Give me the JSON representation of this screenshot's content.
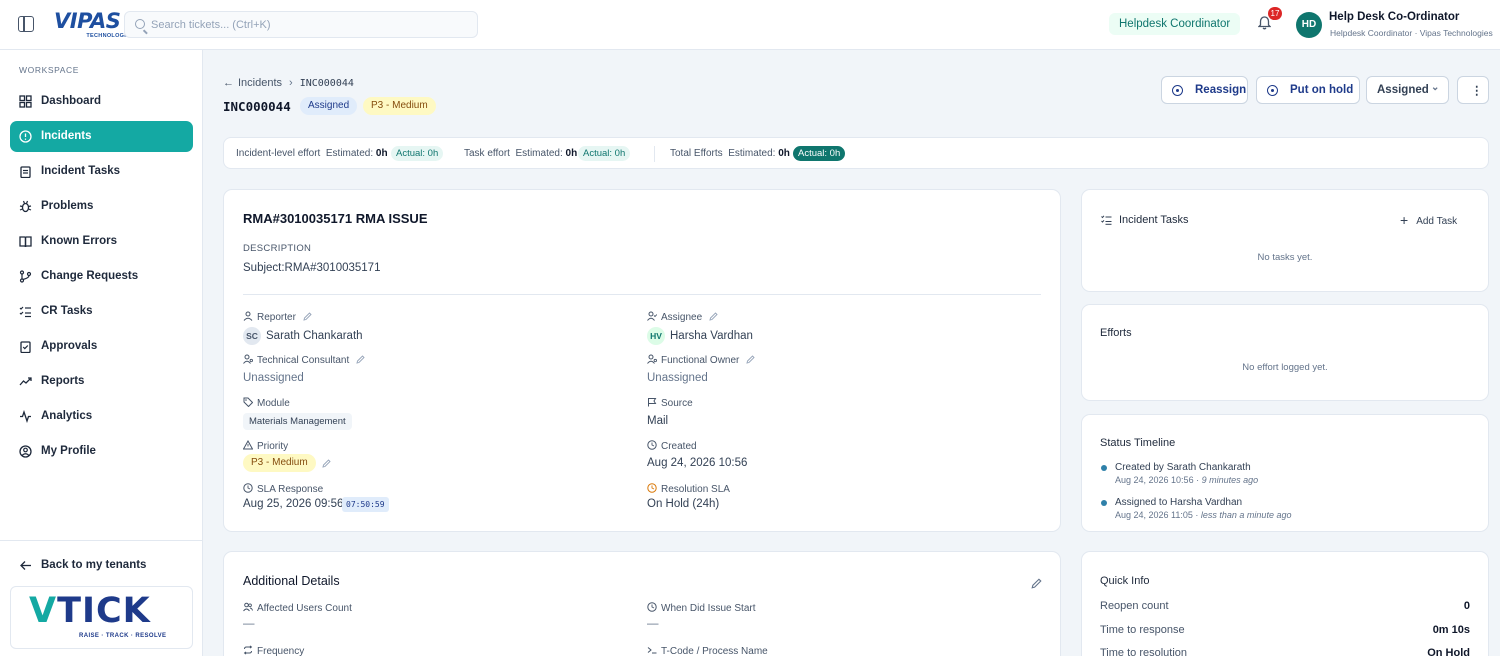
{
  "topbar": {
    "logo": "VIPAS",
    "logo_sub": "TECHNOLOGIES",
    "search_placeholder": "Search tickets... (Ctrl+K)",
    "role": "Helpdesk Coordinator",
    "notifications_count": "17",
    "avatar_initials": "HD",
    "user_name": "Help Desk Co-Ordinator",
    "user_sub": "Helpdesk Coordinator · Vipas Technologies"
  },
  "sidebar": {
    "section_label": "WORKSPACE",
    "items": [
      {
        "label": "Dashboard",
        "icon": "grid-icon"
      },
      {
        "label": "Incidents",
        "icon": "alert-circle-icon",
        "active": true
      },
      {
        "label": "Incident Tasks",
        "icon": "clipboard-icon"
      },
      {
        "label": "Problems",
        "icon": "bug-icon"
      },
      {
        "label": "Known Errors",
        "icon": "book-icon"
      },
      {
        "label": "Change Requests",
        "icon": "git-branch-icon"
      },
      {
        "label": "CR Tasks",
        "icon": "list-checks-icon"
      },
      {
        "label": "Approvals",
        "icon": "clipboard-check-icon"
      },
      {
        "label": "Reports",
        "icon": "trend-icon"
      },
      {
        "label": "Analytics",
        "icon": "activity-icon"
      },
      {
        "label": "My Profile",
        "icon": "user-circle-icon"
      }
    ],
    "back_label": "Back to my tenants",
    "brand": "TICK",
    "brand_v": "V",
    "brand_tagline": "RAISE · TRACK · RESOLVE"
  },
  "header": {
    "breadcrumb_parent": "Incidents",
    "breadcrumb_current": "INC000044",
    "incident_id": "INC000044",
    "status_pill": "Assigned",
    "priority_pill": "P3 - Medium",
    "reassign_label": "Reassign",
    "hold_label": "Put on hold",
    "status_select": "Assigned",
    "more_label": "⋮"
  },
  "efforts_bar": {
    "incident_label": "Incident-level effort",
    "task_label": "Task effort",
    "total_label": "Total Efforts",
    "estimated_word": "Estimated:",
    "incident_estimated": "0h",
    "incident_actual": "Actual: 0h",
    "task_estimated": "0h",
    "task_actual": "Actual: 0h",
    "total_estimated": "0h",
    "total_actual": "Actual: 0h"
  },
  "incident": {
    "title": "RMA#3010035171 RMA ISSUE",
    "description_label": "DESCRIPTION",
    "description": "Subject:RMA#3010035171",
    "reporter_label": "Reporter",
    "reporter_initials": "SC",
    "reporter": "Sarath Chankarath",
    "assignee_label": "Assignee",
    "assignee_initials": "HV",
    "assignee": "Harsha Vardhan",
    "tech_consultant_label": "Technical Consultant",
    "tech_consultant": "Unassigned",
    "functional_owner_label": "Functional Owner",
    "functional_owner": "Unassigned",
    "module_label": "Module",
    "module": "Materials Management",
    "source_label": "Source",
    "source": "Mail",
    "priority_label": "Priority",
    "priority": "P3 - Medium",
    "created_label": "Created",
    "created": "Aug 24, 2026 10:56",
    "sla_response_label": "SLA Response",
    "sla_response": "Aug 25, 2026 09:56",
    "sla_timer": "07:50:59",
    "resolution_sla_label": "Resolution SLA",
    "resolution_sla": "On Hold (24h)"
  },
  "additional": {
    "title": "Additional Details",
    "affected_label": "Affected Users Count",
    "affected_value": "—",
    "issue_start_label": "When Did Issue Start",
    "issue_start_value": "—",
    "frequency_label": "Frequency",
    "tcode_label": "T-Code / Process Name"
  },
  "tasks_panel": {
    "title": "Incident Tasks",
    "add_label": "Add Task",
    "empty": "No tasks yet."
  },
  "efforts_panel": {
    "title": "Efforts",
    "empty": "No effort logged yet."
  },
  "timeline": {
    "title": "Status Timeline",
    "events": [
      {
        "text": "Created by Sarath Chankarath",
        "time": "Aug 24, 2026 10:56 · ",
        "ago": "9 minutes ago"
      },
      {
        "text": "Assigned to Harsha Vardhan",
        "time": "Aug 24, 2026 11:05 · ",
        "ago": "less than a minute ago"
      }
    ]
  },
  "quick_info": {
    "title": "Quick Info",
    "rows": [
      {
        "label": "Reopen count",
        "value": "0"
      },
      {
        "label": "Time to response",
        "value": "0m 10s"
      },
      {
        "label": "Time to resolution",
        "value": "On Hold"
      }
    ]
  },
  "colors": {
    "accent": "#14a9a3",
    "brand_blue": "#1e3a8a",
    "notification": "#dc2626"
  }
}
